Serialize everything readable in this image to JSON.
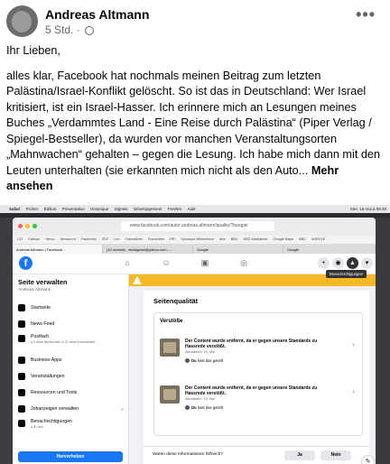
{
  "post": {
    "author": "Andreas Altmann",
    "time": "5 Std. ·",
    "menu_icon": "more-dots-icon",
    "greeting": "Ihr Lieben,",
    "body": "alles klar, Facebook hat nochmals meinen Beitrag zum letzten Palästina/Israel-Konflikt gelöscht. So ist das in Deutschland: Wer Israel kritisiert, ist ein Israel-Hasser. Ich erinnere mich an Lesungen meines Buches „Verdammtes Land - Eine Reise durch Palästina“ (Piper Verlag / Spiegel-Bestseller), da wurden vor manchen Veranstaltungsorten „Mahnwachen“ gehalten – gegen die Lesung. Ich habe mich dann mit den Leuten unterhalten (sie erkannten mich nicht als den Auto...",
    "more": "Mehr ansehen"
  },
  "screenshot": {
    "menubar": [
      "Safari",
      "Fichier",
      "Édition",
      "Présentation",
      "Historique",
      "Signets",
      "Développement",
      "Fenêtre",
      "Aide"
    ],
    "menubar_right": "Mer. 19 mai à 08:49",
    "url": "www.facebook.com/autor.andreas.altmann/quality/?tooqpsi",
    "bookmarks": [
      "CO",
      "Outlook",
      "Yahoo",
      "Amazon.fr",
      "Facebook",
      "ZDF",
      "Leo",
      "Francethier",
      "Francetrifo",
      "RFI",
      "Synonym-Wörterbuch",
      "arte",
      "BBC",
      "ARD-Mediathek",
      "Google Maps",
      "BBC",
      "WDR.DE"
    ],
    "tabs": [
      "Andreas Altmann | Facebook",
      "(10 unread) - aboriganol@yahoo.com -…",
      "Google",
      "Google"
    ],
    "tooltip": "Benachrichtigungen",
    "sidebar": {
      "title": "Seite verwalten",
      "subtitle": "Andreas Altmann",
      "items": [
        {
          "label": "Startseite",
          "sub": ""
        },
        {
          "label": "News Feed",
          "sub": ""
        },
        {
          "label": "Postfach",
          "sub": "● 4 neue Nachrichten & 21 neue Kommentare"
        },
        {
          "label": "Business-Apps",
          "sub": ""
        },
        {
          "label": "Veranstaltungen",
          "sub": ""
        },
        {
          "label": "Ressourcen und Tools",
          "sub": ""
        },
        {
          "label": "Jobanzeigen verwalten",
          "sub": ""
        },
        {
          "label": "Benachrichtigungen",
          "sub": "● 81 neu"
        }
      ],
      "promote": "Hervorheben"
    },
    "main": {
      "heading": "Seitenqualität",
      "card_title": "Verstöße",
      "violations": [
        {
          "text": "Der Content wurde entfernt, da er gegen unsere Standards zu Hassrede verstößt.",
          "date": "Aktualisiert: 19. Mai",
          "shared_by": "Du",
          "shared_rest": " hast das geteilt"
        },
        {
          "text": "Der Content wurde entfernt, da er gegen unsere Standards zu Hassrede verstößt.",
          "date": "Aktualisiert: 19. Mai",
          "shared_by": "Du",
          "shared_rest": " hast das geteilt"
        }
      ],
      "helpful_question": "Waren diese Informationen hilfreich?",
      "yes": "Ja",
      "no": "Nein"
    }
  }
}
